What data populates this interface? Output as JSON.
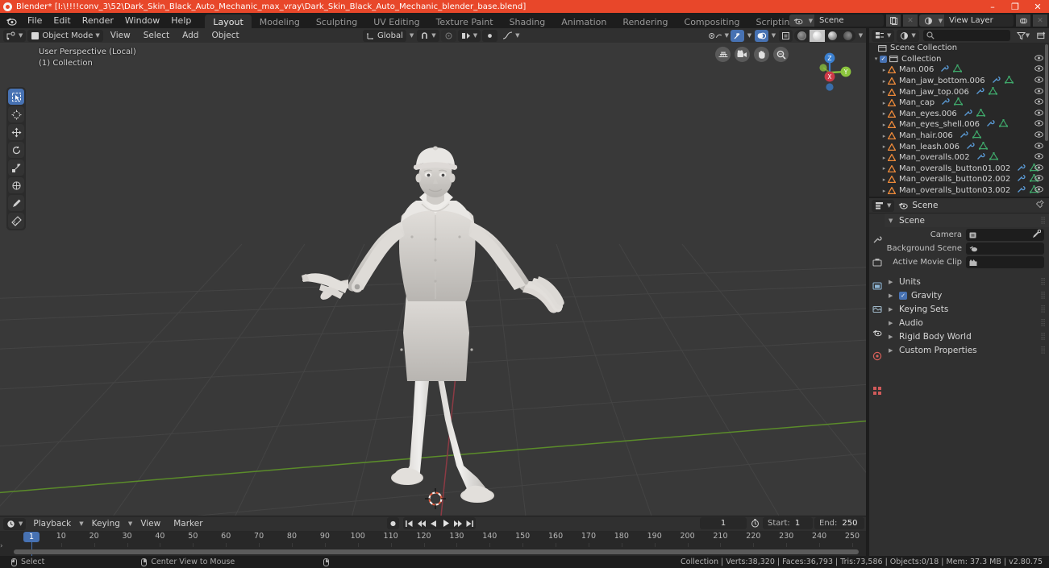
{
  "window": {
    "title": "Blender* [I:\\!!!!conv_3\\52\\Dark_Skin_Black_Auto_Mechanic_max_vray\\Dark_Skin_Black_Auto_Mechanic_blender_base.blend]",
    "minimize": "–",
    "maximize": "❐",
    "close": "✕",
    "titlebar_color": "#e8472a"
  },
  "topbar": {
    "menus": [
      "File",
      "Edit",
      "Render",
      "Window",
      "Help"
    ],
    "workspaces": [
      {
        "label": "Layout",
        "active": true
      },
      {
        "label": "Modeling",
        "active": false
      },
      {
        "label": "Sculpting",
        "active": false
      },
      {
        "label": "UV Editing",
        "active": false
      },
      {
        "label": "Texture Paint",
        "active": false
      },
      {
        "label": "Shading",
        "active": false
      },
      {
        "label": "Animation",
        "active": false
      },
      {
        "label": "Rendering",
        "active": false
      },
      {
        "label": "Compositing",
        "active": false
      },
      {
        "label": "Scripting",
        "active": false
      },
      {
        "label": "+",
        "active": false
      }
    ],
    "scene_name": "Scene",
    "view_layer_name": "View Layer"
  },
  "viewport_header": {
    "mode": "Object Mode",
    "menus": [
      "View",
      "Select",
      "Add",
      "Object"
    ],
    "transform_orientation": "Global",
    "snap_label": "Snap",
    "proportional_label": "Proportional Editing"
  },
  "viewport": {
    "perspective_line1": "User Perspective (Local)",
    "perspective_line2": "(1) Collection",
    "gizmo_axes": [
      "X",
      "Y",
      "Z"
    ],
    "nav_icons": [
      "grid-toggle-icon",
      "camera-view-icon",
      "pan-view-icon",
      "zoom-view-icon"
    ],
    "tools": [
      "select-box-tool",
      "cursor-tool",
      "move-tool",
      "rotate-tool",
      "scale-tool",
      "transform-tool",
      "annotate-tool",
      "measure-tool"
    ],
    "background_color": "#393939"
  },
  "timeline": {
    "editor_menus": [
      "Playback",
      "Keying",
      "View",
      "Marker"
    ],
    "current_frame": "1",
    "start_label": "Start:",
    "start_value": "1",
    "end_label": "End:",
    "end_value": "250",
    "ticks": [
      1,
      10,
      20,
      30,
      40,
      50,
      60,
      70,
      80,
      90,
      100,
      110,
      120,
      130,
      140,
      150,
      160,
      170,
      180,
      190,
      200,
      210,
      220,
      230,
      240,
      250
    ],
    "playhead_frame": "1"
  },
  "outliner": {
    "search_placeholder": "",
    "rows": [
      {
        "label": "Scene Collection",
        "indent": 0,
        "icon": "collection-icon",
        "disclosure": false,
        "checkbox": false,
        "data_icons": [],
        "eye": false
      },
      {
        "label": "Collection",
        "indent": 1,
        "icon": "collection-icon",
        "disclosure": true,
        "checkbox": true,
        "data_icons": [],
        "eye": true
      },
      {
        "label": "Man.006",
        "indent": 2,
        "icon": "mesh-object-icon",
        "disclosure": true,
        "checkbox": false,
        "data_icons": [
          "modifier-icon",
          "mesh-data-icon"
        ],
        "eye": true
      },
      {
        "label": "Man_jaw_bottom.006",
        "indent": 2,
        "icon": "mesh-object-icon",
        "disclosure": true,
        "checkbox": false,
        "data_icons": [
          "modifier-icon",
          "mesh-data-icon"
        ],
        "eye": true
      },
      {
        "label": "Man_jaw_top.006",
        "indent": 2,
        "icon": "mesh-object-icon",
        "disclosure": true,
        "checkbox": false,
        "data_icons": [
          "modifier-icon",
          "mesh-data-icon"
        ],
        "eye": true
      },
      {
        "label": "Man_cap",
        "indent": 2,
        "icon": "mesh-object-icon",
        "disclosure": true,
        "checkbox": false,
        "data_icons": [
          "modifier-icon",
          "mesh-data-icon"
        ],
        "eye": true
      },
      {
        "label": "Man_eyes.006",
        "indent": 2,
        "icon": "mesh-object-icon",
        "disclosure": true,
        "checkbox": false,
        "data_icons": [
          "modifier-icon",
          "mesh-data-icon"
        ],
        "eye": true
      },
      {
        "label": "Man_eyes_shell.006",
        "indent": 2,
        "icon": "mesh-object-icon",
        "disclosure": true,
        "checkbox": false,
        "data_icons": [
          "modifier-icon",
          "mesh-data-icon"
        ],
        "eye": true
      },
      {
        "label": "Man_hair.006",
        "indent": 2,
        "icon": "mesh-object-icon",
        "disclosure": true,
        "checkbox": false,
        "data_icons": [
          "modifier-icon",
          "mesh-data-icon"
        ],
        "eye": true
      },
      {
        "label": "Man_leash.006",
        "indent": 2,
        "icon": "mesh-object-icon",
        "disclosure": true,
        "checkbox": false,
        "data_icons": [
          "modifier-icon",
          "mesh-data-icon"
        ],
        "eye": true
      },
      {
        "label": "Man_overalls.002",
        "indent": 2,
        "icon": "mesh-object-icon",
        "disclosure": true,
        "checkbox": false,
        "data_icons": [
          "modifier-icon",
          "mesh-data-icon"
        ],
        "eye": true
      },
      {
        "label": "Man_overalls_button01.002",
        "indent": 2,
        "icon": "mesh-object-icon",
        "disclosure": true,
        "checkbox": false,
        "data_icons": [
          "modifier-icon",
          "mesh-data-icon"
        ],
        "eye": true
      },
      {
        "label": "Man_overalls_button02.002",
        "indent": 2,
        "icon": "mesh-object-icon",
        "disclosure": true,
        "checkbox": false,
        "data_icons": [
          "modifier-icon",
          "mesh-data-icon"
        ],
        "eye": true
      },
      {
        "label": "Man_overalls_button03.002",
        "indent": 2,
        "icon": "mesh-object-icon",
        "disclosure": true,
        "checkbox": false,
        "data_icons": [
          "modifier-icon",
          "mesh-data-icon"
        ],
        "eye": true
      }
    ]
  },
  "properties": {
    "breadcrumb": "Scene",
    "panel_scene": "Scene",
    "rows": [
      {
        "label": "Camera",
        "icon": "camera-icon",
        "value": "",
        "eyedropper": true
      },
      {
        "label": "Background Scene",
        "icon": "scene-icon",
        "value": "",
        "eyedropper": false
      },
      {
        "label": "Active Movie Clip",
        "icon": "clip-icon",
        "value": "",
        "eyedropper": false
      }
    ],
    "panels": [
      {
        "label": "Units",
        "checkbox": false
      },
      {
        "label": "Gravity",
        "checkbox": true
      },
      {
        "label": "Keying Sets",
        "checkbox": false
      },
      {
        "label": "Audio",
        "checkbox": false
      },
      {
        "label": "Rigid Body World",
        "checkbox": false
      },
      {
        "label": "Custom Properties",
        "checkbox": false
      }
    ],
    "tabs": [
      "tool-tab",
      "render-tab",
      "output-tab",
      "view-layer-tab",
      "scene-tab",
      "world-tab",
      "object-tab"
    ]
  },
  "statusbar": {
    "left_items": [
      {
        "mouse": "left",
        "label": "Select"
      },
      {
        "mouse": "middle",
        "label": "Center View to Mouse"
      },
      {
        "mouse": "right",
        "label": ""
      }
    ],
    "stats": "Collection | Verts:38,320 | Faces:36,793 | Tris:73,586 | Objects:0/18 | Mem: 37.3 MB | v2.80.75"
  },
  "colors": {
    "accent_blue": "#4772b3",
    "title_orange": "#e8472a",
    "mesh_orange": "#ed8a3a",
    "mesh_green": "#3fa86b",
    "modifier_blue": "#5b9cd8",
    "axis_x": "#cf3a48",
    "axis_y": "#8cc63e",
    "axis_z": "#3a7fcf"
  }
}
